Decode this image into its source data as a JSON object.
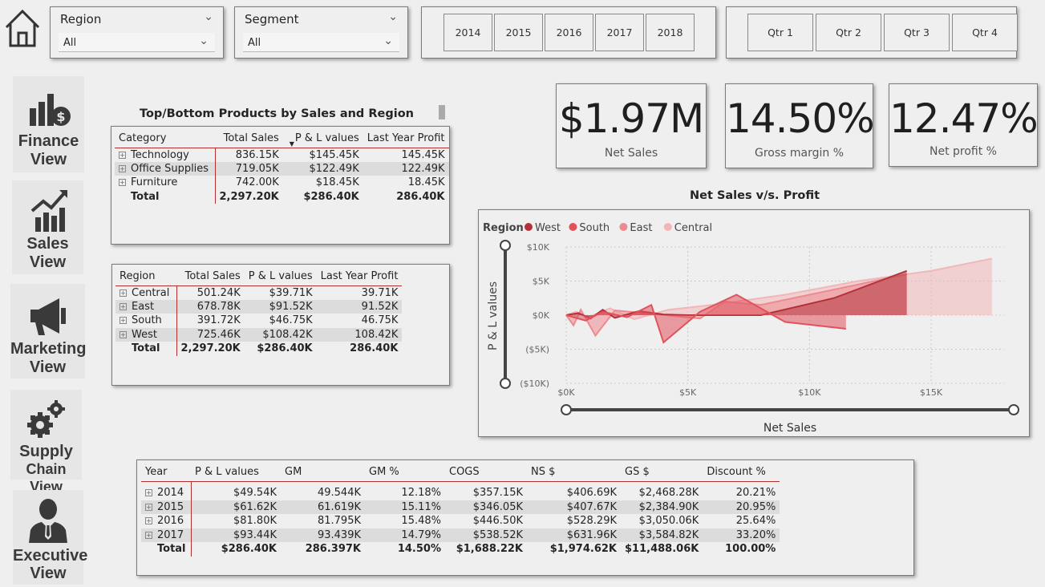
{
  "filters": {
    "region": {
      "title": "Region",
      "value": "All"
    },
    "segment": {
      "title": "Segment",
      "value": "All"
    },
    "years": [
      "2014",
      "2015",
      "2016",
      "2017",
      "2018"
    ],
    "quarters": [
      "Qtr 1",
      "Qtr 2",
      "Qtr 3",
      "Qtr 4"
    ]
  },
  "nav": [
    {
      "line1": "Finance",
      "line2": "View",
      "icon": "finance-icon"
    },
    {
      "line1": "Sales",
      "line2": "View",
      "icon": "sales-chart-icon"
    },
    {
      "line1": "Marketing",
      "line2": "View",
      "icon": "megaphone-icon"
    },
    {
      "line1": "Supply",
      "line2": "Chain View",
      "icon": "gears-icon"
    },
    {
      "line1": "Executive",
      "line2": "View",
      "icon": "executive-icon"
    }
  ],
  "kpis": [
    {
      "value": "$1.97M",
      "label": "Net Sales"
    },
    {
      "value": "14.50%",
      "label": "Gross margin %"
    },
    {
      "value": "12.47%",
      "label": "Net profit %"
    }
  ],
  "products_table": {
    "title": "Top/Bottom Products by Sales and Region",
    "headers": [
      "Category",
      "Total Sales",
      "P & L values",
      "Last Year Profit"
    ],
    "rows": [
      [
        "Technology",
        "836.15K",
        "$145.45K",
        "145.45K"
      ],
      [
        "Office Supplies",
        "719.05K",
        "$122.49K",
        "122.49K"
      ],
      [
        "Furniture",
        "742.00K",
        "$18.45K",
        "18.45K"
      ]
    ],
    "total": [
      "Total",
      "2,297.20K",
      "$286.40K",
      "286.40K"
    ]
  },
  "region_table": {
    "headers": [
      "Region",
      "Total Sales",
      "P & L values",
      "Last Year Profit"
    ],
    "rows": [
      [
        "Central",
        "501.24K",
        "$39.71K",
        "39.71K"
      ],
      [
        "East",
        "678.78K",
        "$91.52K",
        "91.52K"
      ],
      [
        "South",
        "391.72K",
        "$46.75K",
        "46.75K"
      ],
      [
        "West",
        "725.46K",
        "$108.42K",
        "108.42K"
      ]
    ],
    "total": [
      "Total",
      "2,297.20K",
      "$286.40K",
      "286.40K"
    ]
  },
  "year_table": {
    "headers": [
      "Year",
      "P & L values",
      "GM",
      "GM %",
      "COGS",
      "NS $",
      "GS $",
      "Discount %"
    ],
    "rows": [
      [
        "2014",
        "$49.54K",
        "49.544K",
        "12.18%",
        "$357.15K",
        "$406.69K",
        "$2,468.28K",
        "20.21%"
      ],
      [
        "2015",
        "$61.62K",
        "61.619K",
        "15.11%",
        "$346.05K",
        "$407.67K",
        "$2,384.90K",
        "20.95%"
      ],
      [
        "2016",
        "$81.80K",
        "81.795K",
        "15.48%",
        "$446.50K",
        "$528.29K",
        "$3,050.06K",
        "25.64%"
      ],
      [
        "2017",
        "$93.44K",
        "93.439K",
        "14.79%",
        "$538.52K",
        "$631.96K",
        "$3,584.82K",
        "33.20%"
      ]
    ],
    "total": [
      "Total",
      "$286.40K",
      "286.397K",
      "14.50%",
      "$1,688.22K",
      "$1,974.62K",
      "$11,488.06K",
      "100.00%"
    ]
  },
  "chart_data": {
    "type": "area",
    "title": "Net Sales v/s. Profit",
    "xlabel": "Net Sales",
    "ylabel": "P & L values",
    "legend_title": "Region",
    "legend_position": "top-left",
    "xlim": [
      0,
      18000
    ],
    "ylim": [
      -10000,
      10000
    ],
    "xticks": [
      "$0K",
      "$5K",
      "$10K",
      "$15K"
    ],
    "yticks": [
      "$10K",
      "$5K",
      "$0K",
      "($5K)",
      "($10K)"
    ],
    "grid": true,
    "series": [
      {
        "name": "West",
        "color": "#b5313a",
        "points": [
          [
            0,
            0
          ],
          [
            500,
            300
          ],
          [
            1000,
            -500
          ],
          [
            1500,
            800
          ],
          [
            2000,
            -400
          ],
          [
            3000,
            600
          ],
          [
            4000,
            100
          ],
          [
            5000,
            0
          ],
          [
            8000,
            0
          ],
          [
            11000,
            2500
          ],
          [
            14000,
            6500
          ]
        ]
      },
      {
        "name": "South",
        "color": "#e0525c",
        "points": [
          [
            0,
            0
          ],
          [
            800,
            -800
          ],
          [
            1500,
            500
          ],
          [
            2500,
            -300
          ],
          [
            3500,
            1500
          ],
          [
            4000,
            -4000
          ],
          [
            5500,
            500
          ],
          [
            7000,
            3000
          ],
          [
            9000,
            -1000
          ],
          [
            11500,
            -2000
          ]
        ]
      },
      {
        "name": "East",
        "color": "#ec8a90",
        "points": [
          [
            0,
            0
          ],
          [
            300,
            -1500
          ],
          [
            600,
            800
          ],
          [
            1200,
            -3000
          ],
          [
            2000,
            700
          ],
          [
            3500,
            200
          ],
          [
            5500,
            -500
          ],
          [
            6500,
            2000
          ],
          [
            8000,
            1500
          ],
          [
            10000,
            3000
          ],
          [
            14000,
            6000
          ]
        ]
      },
      {
        "name": "Central",
        "color": "#f2b6b9",
        "points": [
          [
            0,
            0
          ],
          [
            400,
            500
          ],
          [
            900,
            -300
          ],
          [
            1800,
            1000
          ],
          [
            2800,
            -600
          ],
          [
            4200,
            800
          ],
          [
            6000,
            1500
          ],
          [
            9000,
            3000
          ],
          [
            12000,
            5000
          ],
          [
            15000,
            6500
          ],
          [
            17500,
            8300
          ]
        ]
      }
    ]
  }
}
